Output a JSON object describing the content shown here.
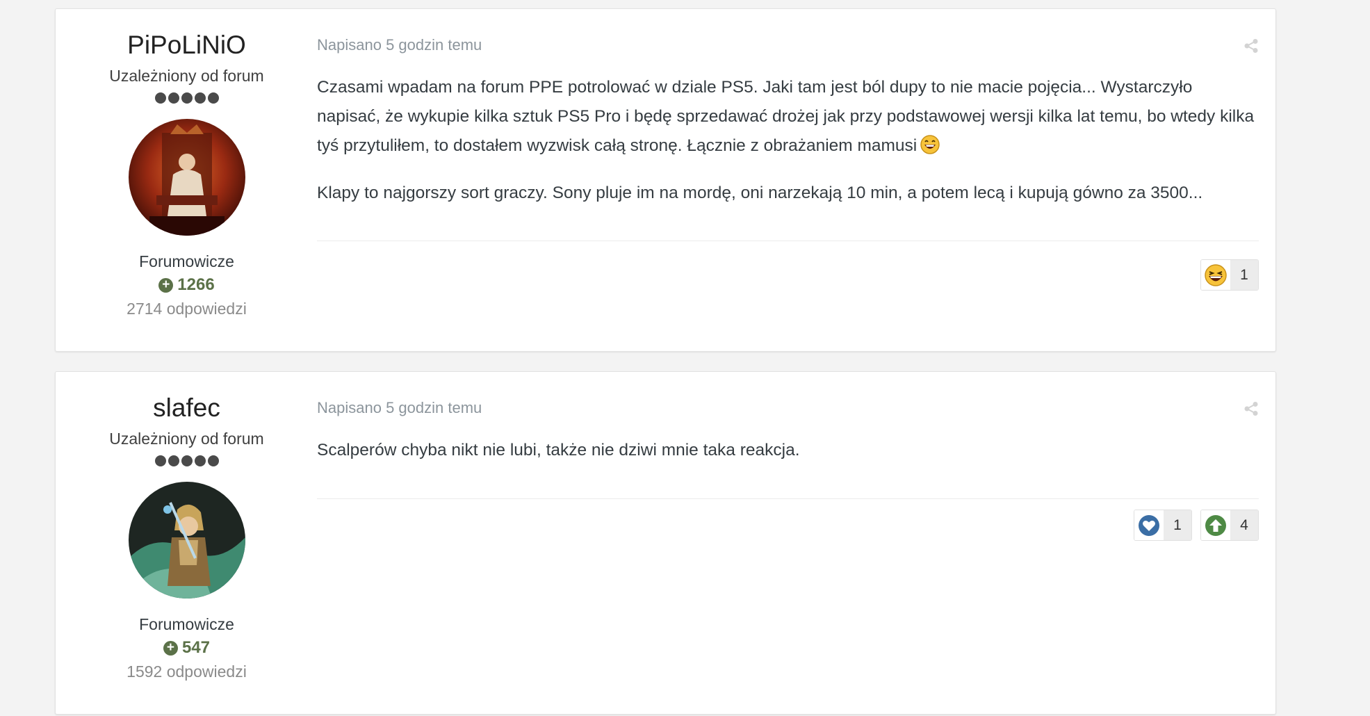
{
  "posts": [
    {
      "author": {
        "name": "PiPoLiNiO",
        "rank": "Uzależniony od forum",
        "group": "Forumowicze",
        "reputation": "1266",
        "replies": "2714 odpowiedzi"
      },
      "date": "Napisano 5 godzin temu",
      "paragraphs": [
        "Czasami wpadam na forum PPE potrolować w dziale PS5. Jaki tam jest ból dupy to nie macie pojęcia... Wystarczyło napisać, że wykupie kilka sztuk PS5 Pro i będę sprzedawać drożej jak przy podstawowej wersji kilka lat temu, bo wtedy kilka tyś przytuliłem, to dostałem wyzwisk całą stronę. Łącznie z obrażaniem mamusi",
        "Klapy to najgorszy sort graczy. Sony pluje im na mordę, oni narzekają 10 min, a potem lecą i kupują gówno za 3500..."
      ],
      "reactions": [
        {
          "icon": "laughing-emoji-icon",
          "count": "1"
        }
      ]
    },
    {
      "author": {
        "name": "slafec",
        "rank": "Uzależniony od forum",
        "group": "Forumowicze",
        "reputation": "547",
        "replies": "1592 odpowiedzi"
      },
      "date": "Napisano 5 godzin temu",
      "paragraphs": [
        "Scalperów chyba nikt nie lubi, także nie dziwi mnie taka reakcja."
      ],
      "reactions": [
        {
          "icon": "heart-icon",
          "count": "1"
        },
        {
          "icon": "upvote-icon",
          "count": "4"
        }
      ]
    }
  ],
  "colors": {
    "reputation": "#5b7148",
    "heart": "#3b6ea5",
    "upvote": "#4e8a45"
  }
}
